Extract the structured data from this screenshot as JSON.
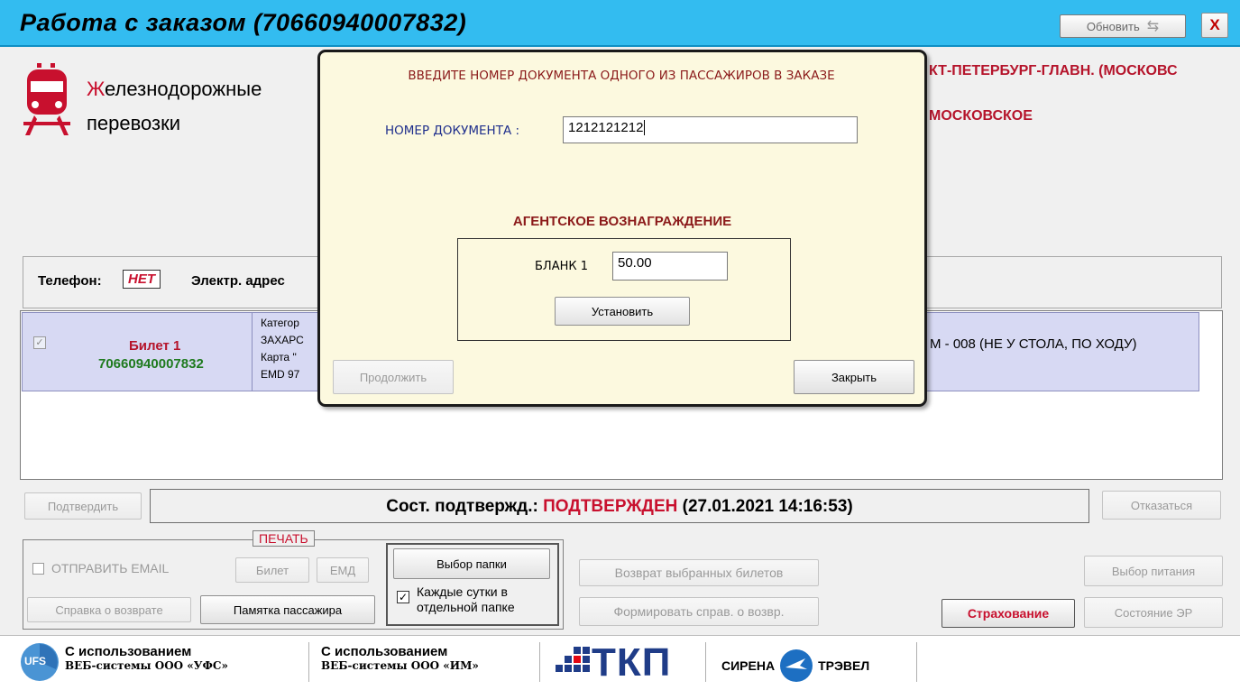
{
  "window": {
    "title": "Работа с заказом (70660940007832)",
    "refresh_label": "Обновить",
    "close_glyph": "X"
  },
  "header": {
    "rail_line1_first": "Ж",
    "rail_line1_rest": "елезнодорожные",
    "rail_line2": "перевозки",
    "route_line1": "КТ-ПЕТЕРБУРГ-ГЛАВН. (МОСКОВС",
    "route_line2": "МОСКОВСКОЕ"
  },
  "contact": {
    "phone_label": "Телефон:",
    "phone_value": "НЕТ",
    "email_label": "Электр. адрес"
  },
  "ticket": {
    "checked": true,
    "name": "Билет 1",
    "number": "70660940007832",
    "details": [
      "Категор",
      "ЗАХАРС",
      "Карта \"",
      "EMD 97"
    ],
    "seat": "М - 008 (НЕ У СТОЛА, ПО ХОДУ)"
  },
  "modal": {
    "heading": "ВВЕДИТЕ НОМЕР ДОКУМЕНТА ОДНОГО ИЗ ПАССАЖИРОВ В ЗАКАЗЕ",
    "doc_label": "НОМЕР ДОКУМЕНТА :",
    "doc_value": "1212121212",
    "agent_heading": "АГЕНТСКОЕ ВОЗНАГРАЖДЕНИЕ",
    "blank_label": "БЛАНК 1",
    "blank_value": "50.00",
    "set_button": "Установить",
    "continue_button": "Продолжить",
    "close_button": "Закрыть"
  },
  "status_line": {
    "confirm_button": "Подтвердить",
    "label": "Сост. подтвержд.:",
    "state": "ПОДТВЕРЖДЕН",
    "timestamp": "(27.01.2021 14:16:53)",
    "refuse_button": "Отказаться"
  },
  "bottom": {
    "send_email": "ОТПРАВИТЬ EMAIL",
    "print_label": "ПЕЧАТЬ",
    "ticket_button": "Билет",
    "emd_button": "ЕМД",
    "refund_ref_button": "Справка о возврате",
    "passenger_memo_button": "Памятка пассажира",
    "choose_folder_button": "Выбор папки",
    "daily_folder_line1": "Каждые сутки в",
    "daily_folder_line2": "отдельной папке",
    "daily_folder_checked": true,
    "return_selected_button": "Возврат выбранных билетов",
    "form_refund_button": "Формировать справ. о возвр.",
    "meal_button": "Выбор питания",
    "insurance_button": "Страхование",
    "er_state_button": "Состояние  ЭР"
  },
  "footer": {
    "ufs_line1": "С использованием",
    "ufs_line2": "ВЕБ-системы ООО «УФС»",
    "ufs_logo_text": "UFS",
    "im_line1": "С использованием",
    "im_line2": "ВЕБ-системы ООО «ИМ»",
    "tkp_logo_text": "ТКП",
    "sirena_left": "СИРЕНА",
    "sirena_right": "ТРЭВЕЛ"
  },
  "colors": {
    "titlebar": "#33bcf0",
    "route_red": "#b5142b",
    "ticket_green": "#1e7a1e",
    "modal_bg": "#fcf9df",
    "status_red": "#c8102e"
  }
}
